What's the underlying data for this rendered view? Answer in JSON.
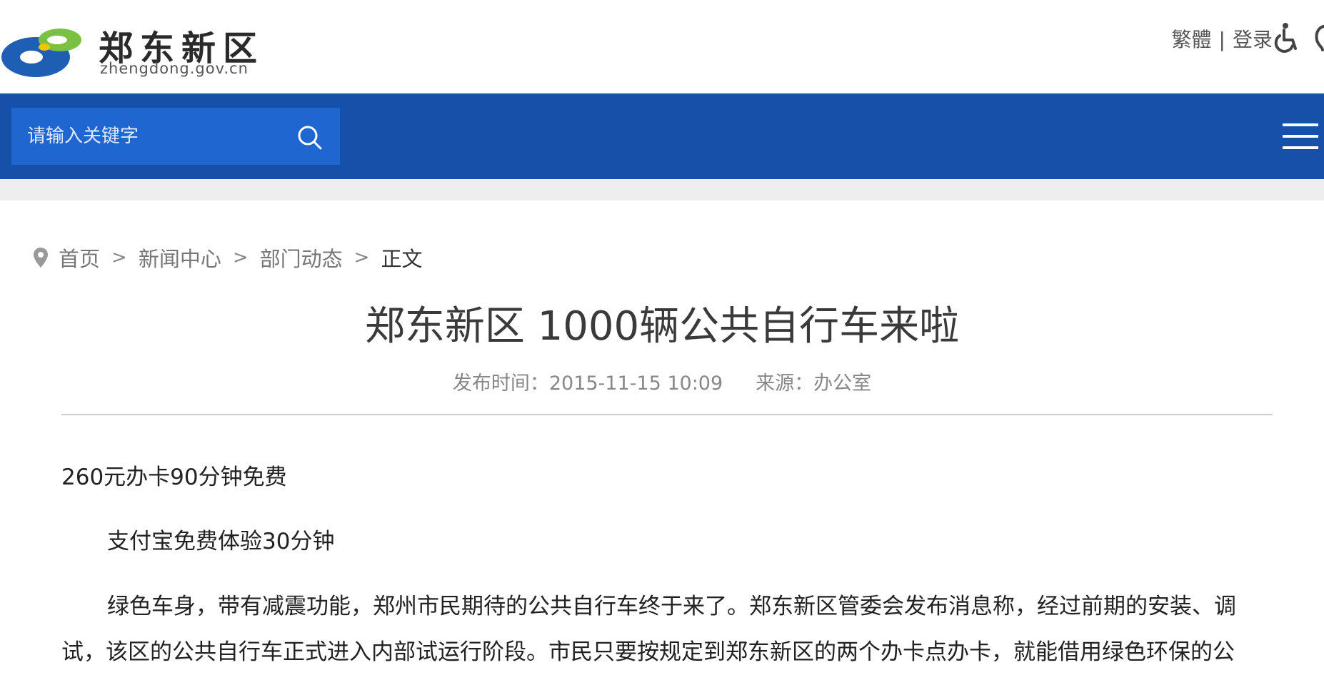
{
  "header": {
    "logo_cn": "郑东新区",
    "logo_en": "zhengdong.gov.cn",
    "traditional_label": "繁體",
    "separator": "|",
    "login_label": "登录",
    "accessibility_icon": "wheelchair-icon",
    "secondary_icon": "ear-icon"
  },
  "navbar": {
    "search_placeholder": "请输入关键字",
    "search_icon": "search-icon",
    "menu_icon": "hamburger-menu-icon"
  },
  "breadcrumb": {
    "items": [
      "首页",
      "新闻中心",
      "部门动态",
      "正文"
    ],
    "separator": ">"
  },
  "article": {
    "title": "郑东新区 1000辆公共自行车来啦",
    "publish_label": "发布时间：",
    "publish_time": "2015-11-15 10:09",
    "source_label": "来源：",
    "source": "办公室",
    "paragraphs": [
      "260元办卡90分钟免费",
      "支付宝免费体验30分钟",
      "绿色车身，带有减震功能，郑州市民期待的公共自行车终于来了。郑东新区管委会发布消息称，经过前期的安装、调试，该区的公共自行车正式进入内部试运行阶段。市民只要按规定到郑东新区的两个办卡点办卡，就能借用绿色环保的公"
    ]
  },
  "colors": {
    "nav_blue": "#1650a8",
    "search_blue": "#1f66d1",
    "logo_blue": "#1e5fb4",
    "logo_green": "#7ac143"
  }
}
